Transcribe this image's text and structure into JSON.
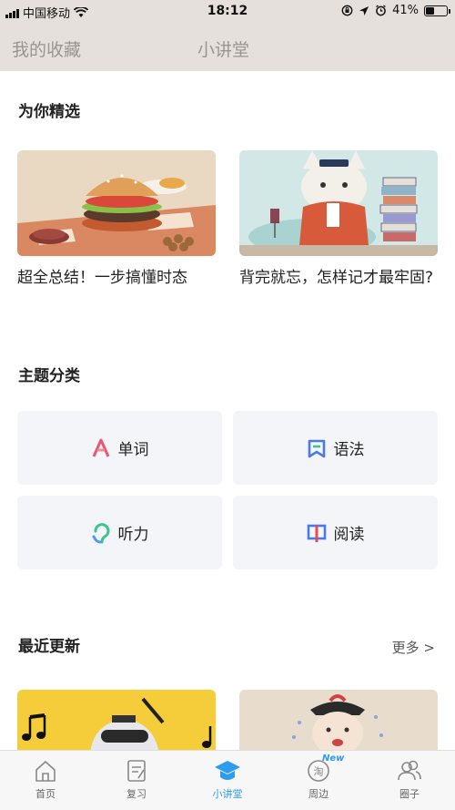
{
  "status_bar": {
    "carrier": "中国移动",
    "time": "18:12",
    "battery": "41%",
    "battery_level": 0.41,
    "icons": [
      "signal-icon",
      "wifi-icon",
      "orientation-lock-icon",
      "location-icon",
      "alarm-icon",
      "battery-icon"
    ]
  },
  "nav": {
    "tab_favorites": "我的收藏",
    "tab_lecture": "小讲堂"
  },
  "featured": {
    "title": "为你精选",
    "cards": [
      {
        "title": "超全总结！一步搞懂时态",
        "image": "burger-illustration"
      },
      {
        "title": "背完就忘，怎样记才最牢固?",
        "image": "cat-with-books-illustration"
      }
    ]
  },
  "categories": {
    "title": "主题分类",
    "items": [
      {
        "label": "单词",
        "icon": "word-icon",
        "color": "#e8586e"
      },
      {
        "label": "语法",
        "icon": "grammar-icon",
        "color": "#4a7ae8"
      },
      {
        "label": "听力",
        "icon": "listening-icon",
        "color": "#3cc48c"
      },
      {
        "label": "阅读",
        "icon": "reading-icon",
        "color": "#e84c4c"
      }
    ]
  },
  "recent": {
    "title": "最近更新",
    "more": "更多 >",
    "cards": [
      {
        "image": "music-robot-illustration"
      },
      {
        "image": "crying-boy-illustration"
      }
    ]
  },
  "tabbar": {
    "items": [
      {
        "label": "首页",
        "icon": "home-icon"
      },
      {
        "label": "复习",
        "icon": "review-icon"
      },
      {
        "label": "小讲堂",
        "icon": "lecture-icon",
        "active": true
      },
      {
        "label": "周边",
        "icon": "taobao-icon",
        "badge": "New"
      },
      {
        "label": "圈子",
        "icon": "community-icon"
      }
    ],
    "accent": "#2d9bf0"
  }
}
